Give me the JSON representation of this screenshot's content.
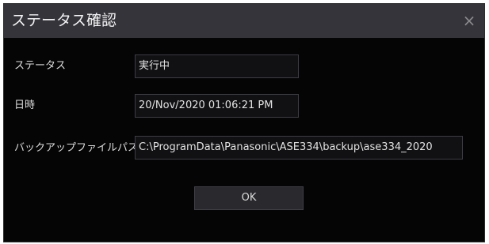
{
  "dialog": {
    "title": "ステータス確認",
    "close_symbol": "×",
    "close_icon": "close-icon"
  },
  "fields": {
    "status": {
      "label": "ステータス",
      "value": "実行中"
    },
    "datetime": {
      "label": "日時",
      "value": "20/Nov/2020 01:06:21 PM"
    },
    "backup_path": {
      "label": "バックアップファイルパス",
      "value": "C:\\ProgramData\\Panasonic\\ASE334\\backup\\ase334_2020"
    }
  },
  "buttons": {
    "ok_label": "OK"
  },
  "colors": {
    "titlebar": "#35343b",
    "background": "#050505",
    "field_background": "#111114",
    "field_border": "#3d3d44"
  }
}
